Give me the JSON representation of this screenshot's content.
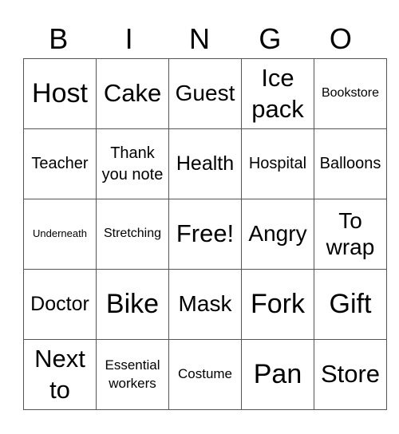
{
  "header": [
    "B",
    "I",
    "N",
    "G",
    "O"
  ],
  "rows": [
    [
      {
        "text": "Host",
        "size": "s36"
      },
      {
        "text": "Cake",
        "size": "s32"
      },
      {
        "text": "Guest",
        "size": "s28"
      },
      {
        "text": "Ice pack",
        "size": "s32"
      },
      {
        "text": "Bookstore",
        "size": "s16"
      }
    ],
    [
      {
        "text": "Teacher",
        "size": "s20"
      },
      {
        "text": "Thank you note",
        "size": "s20"
      },
      {
        "text": "Health",
        "size": "s24"
      },
      {
        "text": "Hospital",
        "size": "s20"
      },
      {
        "text": "Balloons",
        "size": "s20"
      }
    ],
    [
      {
        "text": "Underneath",
        "size": "s14"
      },
      {
        "text": "Stretching",
        "size": "s16"
      },
      {
        "text": "Free!",
        "size": "s32"
      },
      {
        "text": "Angry",
        "size": "s28"
      },
      {
        "text": "To wrap",
        "size": "s28"
      }
    ],
    [
      {
        "text": "Doctor",
        "size": "s24"
      },
      {
        "text": "Bike",
        "size": "s36"
      },
      {
        "text": "Mask",
        "size": "s28"
      },
      {
        "text": "Fork",
        "size": "s36"
      },
      {
        "text": "Gift",
        "size": "s36"
      }
    ],
    [
      {
        "text": "Next to",
        "size": "s32"
      },
      {
        "text": "Essential workers",
        "size": "s18"
      },
      {
        "text": "Costume",
        "size": "s18"
      },
      {
        "text": "Pan",
        "size": "s36"
      },
      {
        "text": "Store",
        "size": "s32"
      }
    ]
  ]
}
